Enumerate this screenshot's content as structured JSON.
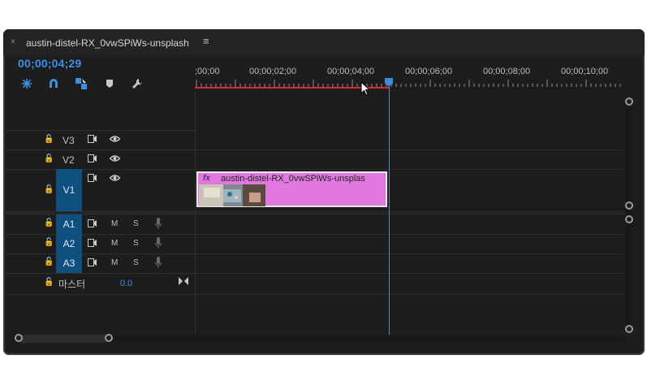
{
  "tab": {
    "close": "×",
    "title": "austin-distel-RX_0vwSPiWs-unsplash",
    "menu": "≡"
  },
  "timecode": "00;00;04;29",
  "tools": [
    {
      "name": "nest-icon"
    },
    {
      "name": "snap-magnet-icon"
    },
    {
      "name": "linked-selection-icon"
    },
    {
      "name": "add-marker-icon"
    },
    {
      "name": "wrench-icon"
    }
  ],
  "ruler": {
    "labels": [
      ";00;00",
      "00;00;02;00",
      "00;00;04;00",
      "00;00;06;00",
      "00;00;08;00",
      "00;00;10;00"
    ]
  },
  "video_tracks": [
    {
      "id": "V3",
      "lock": "🔓",
      "selected": false
    },
    {
      "id": "V2",
      "lock": "🔓",
      "selected": false
    },
    {
      "id": "V1",
      "lock": "🔓",
      "selected": true
    }
  ],
  "audio_tracks": [
    {
      "id": "A1",
      "m": "M",
      "s": "S"
    },
    {
      "id": "A2",
      "m": "M",
      "s": "S"
    },
    {
      "id": "A3",
      "m": "M",
      "s": "S"
    }
  ],
  "master": {
    "label": "마스터",
    "value": "0.0"
  },
  "clip": {
    "fx": "fx",
    "name": "austin-distel-RX_0vwSPiWs-unsplas"
  },
  "colors": {
    "accent": "#3e8fe0",
    "clip": "#e078e0",
    "workarea": "#d7262f",
    "selected_track": "#0f4f7f"
  }
}
